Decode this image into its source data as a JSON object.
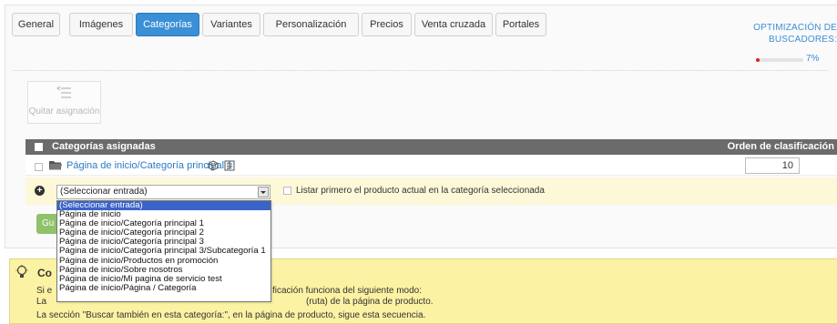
{
  "tabs": [
    {
      "label": "General",
      "active": false
    },
    {
      "label": "Imágenes",
      "active": false
    },
    {
      "label": "Categorías",
      "active": true
    },
    {
      "label": "Variantes",
      "active": false
    },
    {
      "label": "Personalización",
      "active": false
    },
    {
      "label": "Precios",
      "active": false
    },
    {
      "label": "Venta cruzada",
      "active": false
    },
    {
      "label": "Portales",
      "active": false
    }
  ],
  "seo": {
    "title_line1": "OPTIMIZACIÓN DE",
    "title_line2": "BUSCADORES:",
    "percent_label": "7%",
    "progress": 0.07,
    "bar_color": "#dd2222"
  },
  "toolbar": {
    "remove_assignment_label": "Quitar asignación"
  },
  "table": {
    "header_categories": "Categorías asignadas",
    "header_order": "Orden de clasificación",
    "rows": [
      {
        "path": "Página de inicio/Categoría principal 1",
        "order": "10"
      }
    ]
  },
  "add_row": {
    "select_value": "(Seleccionar entrada)",
    "list_first_label": "Listar primero el producto actual en la categoría seleccionada"
  },
  "save_button": {
    "label": "Gu"
  },
  "dropdown": {
    "options": [
      "(Seleccionar entrada)",
      "Página de inicio",
      "Página de inicio/Categoría principal 1",
      "Página de inicio/Categoría principal 2",
      "Página de inicio/Categoría principal 3",
      "Página de inicio/Categoría principal 3/Subcategoría 1",
      "Página de inicio/Productos en promoción",
      "Página de inicio/Sobre nosotros",
      "Página de inicio/Mi pagina de servicio test",
      "Página de inicio/Página / Categoría"
    ],
    "selected_index": 0
  },
  "info": {
    "title": "Co",
    "line1_prefix": "Si e",
    "line1_suffix": "ficación funciona del siguiente modo:",
    "line2_prefix": "La",
    "line2_suffix": "(ruta) de la página de producto.",
    "line3": "La sección \"Buscar también en esta categoría:\", en la página de producto, sigue esta secuencia."
  },
  "colors": {
    "accent": "#3a8fd6",
    "header_bg": "#6b6b6b",
    "highlight_row": "#fdf8d8",
    "info_bg": "#fcf2a3"
  }
}
